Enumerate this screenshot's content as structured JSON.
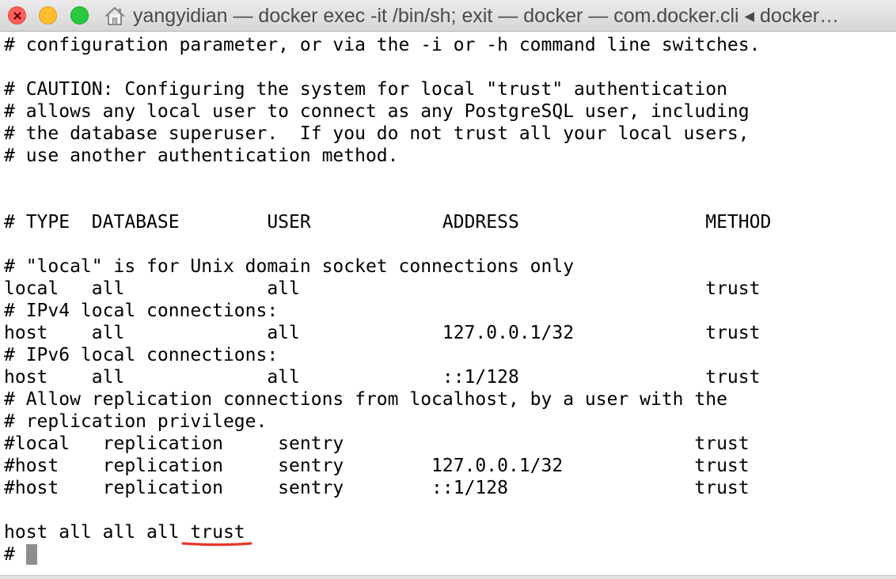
{
  "window": {
    "title": "yangyidian — docker exec -it  /bin/sh; exit — docker — com.docker.cli ◂ docker…",
    "icons": {
      "close": "close-icon",
      "minimize": "minimize-icon",
      "zoom": "zoom-icon",
      "home": "home-folder-icon"
    },
    "colors": {
      "close": "#ff5f57",
      "minimize": "#febc2e",
      "zoom": "#28c840",
      "annotation": "#e8362a",
      "cursor": "#8e8e8e"
    }
  },
  "terminal": {
    "lines": [
      "# configuration parameter, or via the -i or -h command line switches.",
      "",
      "# CAUTION: Configuring the system for local \"trust\" authentication",
      "# allows any local user to connect as any PostgreSQL user, including",
      "# the database superuser.  If you do not trust all your local users,",
      "# use another authentication method.",
      "",
      "",
      "# TYPE  DATABASE        USER            ADDRESS                 METHOD",
      "",
      "# \"local\" is for Unix domain socket connections only",
      "local   all             all                                     trust",
      "# IPv4 local connections:",
      "host    all             all             127.0.0.1/32            trust",
      "# IPv6 local connections:",
      "host    all             all             ::1/128                 trust",
      "# Allow replication connections from localhost, by a user with the",
      "# replication privilege.",
      "#local   replication     sentry                                trust",
      "#host    replication     sentry        127.0.0.1/32            trust",
      "#host    replication     sentry        ::1/128                 trust",
      "",
      "host all all all trust"
    ],
    "prompt": "#"
  }
}
